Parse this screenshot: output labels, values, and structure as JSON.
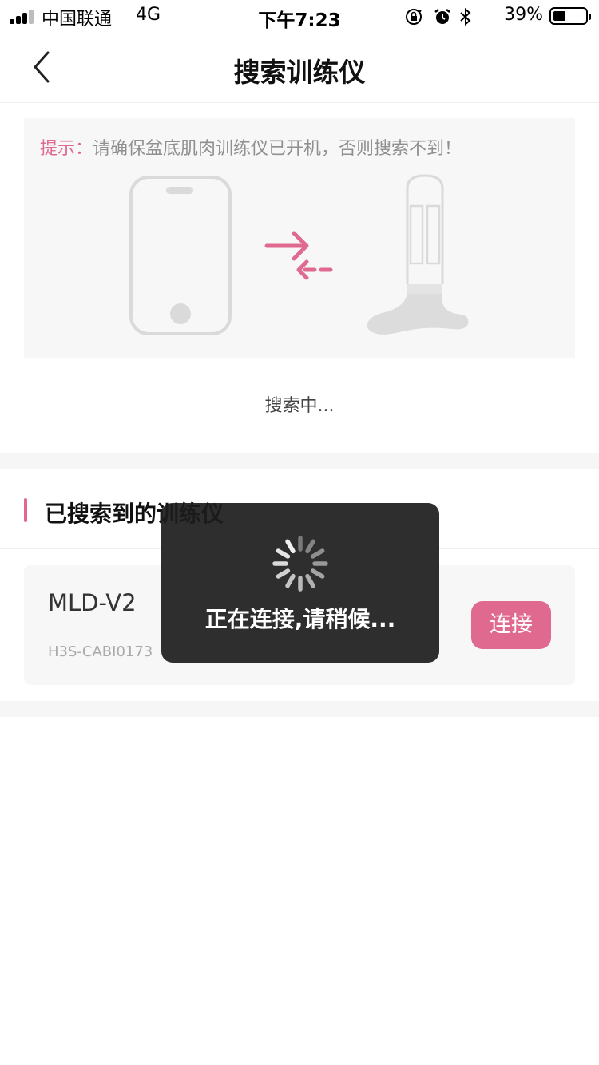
{
  "status_bar": {
    "carrier": "中国联通",
    "network": "4G",
    "time": "下午7:23",
    "battery_percent": "39%",
    "battery_level": 0.39,
    "icons": [
      "signal-icon",
      "orientation-lock-icon",
      "alarm-icon",
      "bluetooth-icon",
      "battery-icon"
    ]
  },
  "nav": {
    "title": "搜索训练仪",
    "back_icon": "chevron-left-icon"
  },
  "tip": {
    "label": "提示：",
    "text": "请确保盆底肌肉训练仪已开机，否则搜索不到！"
  },
  "illustration": {
    "icons": [
      "phone-icon",
      "transfer-arrows-icon",
      "trainer-device-icon"
    ]
  },
  "search": {
    "status": "搜索中..."
  },
  "found_section": {
    "title": "已搜索到的训练仪"
  },
  "devices": [
    {
      "name": "MLD-V2",
      "id": "H3S-CABI0173",
      "connect_label": "连接"
    }
  ],
  "toast": {
    "text": "正在连接,请稍候..."
  },
  "colors": {
    "accent": "#e06a8f",
    "card_bg": "#f7f7f7",
    "toast_bg": "#1c1c1c"
  }
}
